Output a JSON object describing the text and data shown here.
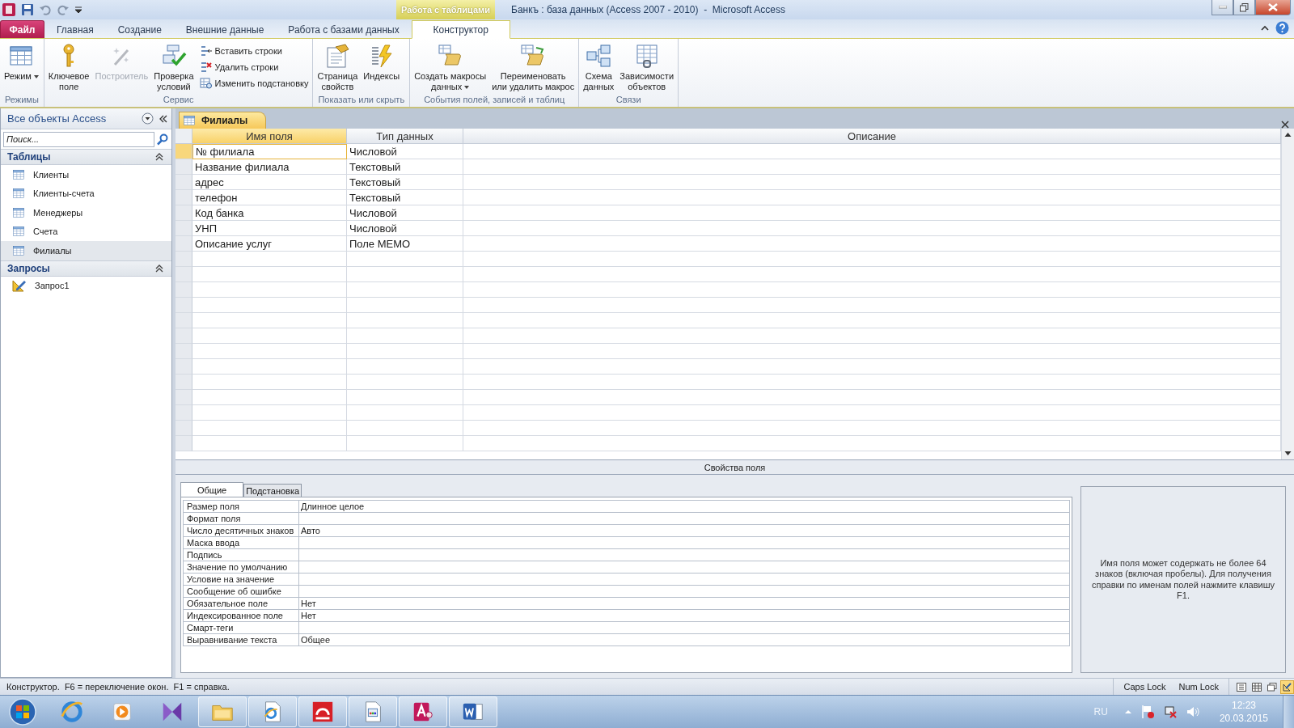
{
  "window": {
    "title": "Банкъ : база данных (Access 2007 - 2010)  -  Microsoft Access",
    "context_label": "Работа с таблицами"
  },
  "ribbon_tabs": [
    {
      "label": "Файл",
      "kind": "file",
      "selected": false
    },
    {
      "label": "Главная",
      "kind": "tab",
      "selected": false
    },
    {
      "label": "Создание",
      "kind": "tab",
      "selected": false
    },
    {
      "label": "Внешние данные",
      "kind": "tab",
      "selected": false
    },
    {
      "label": "Работа с базами данных",
      "kind": "tab",
      "selected": false
    },
    {
      "label": "Конструктор",
      "kind": "tab",
      "selected": true
    }
  ],
  "ribbon_groups": [
    {
      "label": "Режимы",
      "items": [
        {
          "label": "Режим",
          "kind": "large",
          "disabled": false,
          "dropdown": true
        }
      ]
    },
    {
      "label": "Сервис",
      "items": [
        {
          "label": "Ключевое\nполе",
          "kind": "large",
          "disabled": false,
          "dropdown": false
        },
        {
          "label": "Построитель",
          "kind": "large",
          "disabled": true,
          "dropdown": false
        },
        {
          "label": "Проверка\nусловий",
          "kind": "large",
          "disabled": false,
          "dropdown": false
        },
        {
          "label": "Вставить строки",
          "kind": "small",
          "disabled": false,
          "dropdown": false
        },
        {
          "label": "Удалить строки",
          "kind": "small",
          "disabled": false,
          "dropdown": false
        },
        {
          "label": "Изменить подстановку",
          "kind": "small",
          "disabled": false,
          "dropdown": false
        }
      ]
    },
    {
      "label": "Показать или скрыть",
      "items": [
        {
          "label": "Страница\nсвойств",
          "kind": "large",
          "disabled": false,
          "dropdown": false
        },
        {
          "label": "Индексы",
          "kind": "large",
          "disabled": false,
          "dropdown": false
        }
      ]
    },
    {
      "label": "События полей, записей и таблиц",
      "items": [
        {
          "label": "Создать макросы\nданных",
          "kind": "large",
          "disabled": false,
          "dropdown": true
        },
        {
          "label": "Переименовать\nили удалить макрос",
          "kind": "large",
          "disabled": false,
          "dropdown": false
        }
      ]
    },
    {
      "label": "Связи",
      "items": [
        {
          "label": "Схема\nданных",
          "kind": "large",
          "disabled": false,
          "dropdown": false
        },
        {
          "label": "Зависимости\nобъектов",
          "kind": "large",
          "disabled": false,
          "dropdown": false
        }
      ]
    }
  ],
  "navigation": {
    "title": "Все объекты Access",
    "search": {
      "placeholder": "Поиск..."
    },
    "groups": [
      {
        "title": "Таблицы",
        "expanded": true,
        "items": [
          {
            "label": "Клиенты",
            "selected": false
          },
          {
            "label": "Клиенты-счета",
            "selected": false
          },
          {
            "label": "Менеджеры",
            "selected": false
          },
          {
            "label": "Счета",
            "selected": false
          },
          {
            "label": "Филиалы",
            "selected": true
          }
        ]
      },
      {
        "title": "Запросы",
        "expanded": true,
        "items": [
          {
            "label": "Запрос1",
            "selected": false
          }
        ]
      }
    ]
  },
  "document": {
    "tab": {
      "label": "Филиалы"
    },
    "columns": [
      "Имя поля",
      "Тип данных",
      "Описание"
    ],
    "rows": [
      {
        "name": "№ филиала",
        "type": "Числовой",
        "selected": true
      },
      {
        "name": "Название филиала",
        "type": "Текстовый",
        "selected": false
      },
      {
        "name": "адрес",
        "type": "Текстовый",
        "selected": false
      },
      {
        "name": "телефон",
        "type": "Текстовый",
        "selected": false
      },
      {
        "name": "Код банка",
        "type": "Числовой",
        "selected": false
      },
      {
        "name": "УНП",
        "type": "Числовой",
        "selected": false
      },
      {
        "name": "Описание услуг",
        "type": "Поле MEMO",
        "selected": false
      }
    ]
  },
  "field_properties": {
    "heading": "Свойства поля",
    "tabs": [
      {
        "label": "Общие",
        "selected": true
      },
      {
        "label": "Подстановка",
        "selected": false
      }
    ],
    "rows": [
      {
        "label": "Размер поля",
        "value": "Длинное целое"
      },
      {
        "label": "Формат поля"
      },
      {
        "label": "Число десятичных знаков",
        "value": "Авто"
      },
      {
        "label": "Маска ввода"
      },
      {
        "label": "Подпись"
      },
      {
        "label": "Значение по умолчанию"
      },
      {
        "label": "Условие на значение"
      },
      {
        "label": "Сообщение об ошибке"
      },
      {
        "label": "Обязательное поле",
        "value": "Нет"
      },
      {
        "label": "Индексированное поле",
        "value": "Нет"
      },
      {
        "label": "Смарт-теги"
      },
      {
        "label": "Выравнивание текста",
        "value": "Общее"
      }
    ],
    "help": "Имя поля может содержать не более 64 знаков (включая пробелы). Для получения справки по именам полей нажмите клавишу F1."
  },
  "status_bar": {
    "message": "Конструктор.  F6 = переключение окон.  F1 = справка.",
    "indicators": [
      "Caps Lock",
      "Num Lock"
    ],
    "views": [
      {
        "selected": false
      },
      {
        "selected": false
      },
      {
        "selected": false
      },
      {
        "selected": true
      }
    ]
  },
  "taskbar": {
    "apps": [
      {
        "running": false
      },
      {
        "running": false
      },
      {
        "running": false
      },
      {
        "running": true
      },
      {
        "running": true
      },
      {
        "running": true
      },
      {
        "running": true
      },
      {
        "running": true
      },
      {
        "running": true
      }
    ],
    "language": "RU",
    "time": "12:23",
    "date": "20.03.2015"
  }
}
